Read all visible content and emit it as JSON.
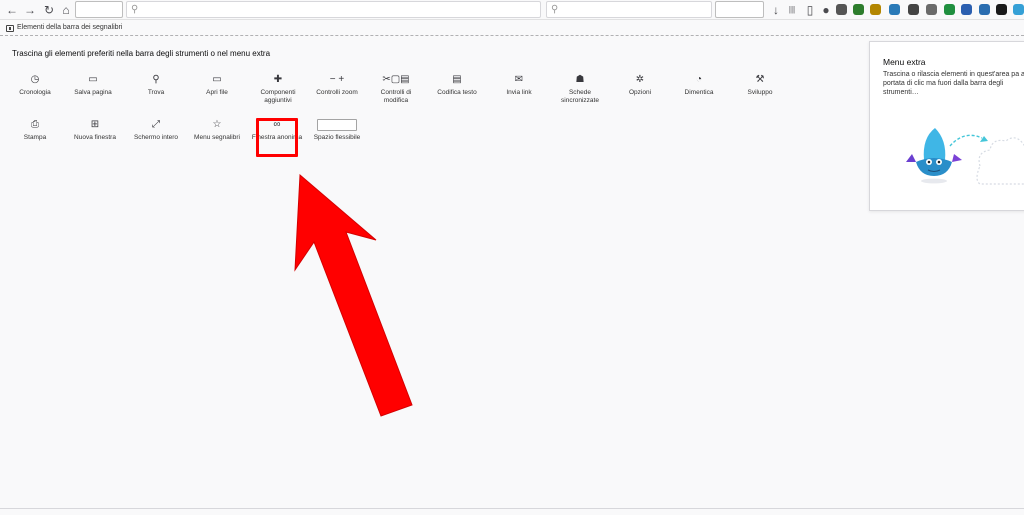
{
  "toolbar": {
    "back_icon": "←",
    "forward_icon": "→",
    "reload_icon": "↻",
    "home_icon": "⌂",
    "search_glyph": "⚲",
    "download_icon": "↓",
    "library_icon": "|||",
    "sidebar_icon": "▯",
    "account_icon": "●",
    "extensions_colors": [
      "#555555",
      "#2d7d2d",
      "#b38600",
      "#2a7ab8",
      "#444444",
      "#6a6a6a",
      "#1f8f3f",
      "#2b5fb0",
      "#2a6db0",
      "#1a1a1a",
      "#35a0d6",
      "#444444"
    ]
  },
  "bookmarks": {
    "label": "Elementi della barra dei segnalibri"
  },
  "main": {
    "instruction": "Trascina gli elementi preferiti nella barra degli strumenti o nel menu extra",
    "row1": [
      {
        "icon": "◷",
        "label": "Cronologia"
      },
      {
        "icon": "▭",
        "label": "Salva pagina"
      },
      {
        "icon": "⚲",
        "label": "Trova"
      },
      {
        "icon": "▭",
        "label": "Apri file"
      },
      {
        "icon": "✚",
        "label": "Componenti aggiuntivi"
      },
      {
        "icon": "− +",
        "label": "Controlli zoom"
      },
      {
        "icon": "✂▢▤",
        "label": "Controlli di modifica"
      },
      {
        "icon": "▤",
        "label": "Codifica testo"
      },
      {
        "icon": "✉",
        "label": "Invia link"
      },
      {
        "icon": "☗",
        "label": "Schede sincronizzate"
      },
      {
        "icon": "✲",
        "label": "Opzioni"
      },
      {
        "icon": "◔",
        "label": "Dimentica"
      },
      {
        "icon": "⚒",
        "label": "Sviluppo"
      }
    ],
    "row2": [
      {
        "icon": "⎙",
        "label": "Stampa"
      },
      {
        "icon": "⊞",
        "label": "Nuova finestra"
      },
      {
        "icon": "⤢",
        "label": "Schermo intero"
      },
      {
        "icon": "☆",
        "label": "Menu segnalibri"
      },
      {
        "icon": "∞",
        "label": "Finestra anonima"
      },
      {
        "icon": "",
        "label": "Spazio flessibile"
      }
    ]
  },
  "panel": {
    "title": "Menu extra",
    "description": "Trascina o rilascia elementi in quest'area pa a portata di clic ma fuori dalla barra degli strumenti…"
  },
  "colors": {
    "highlight": "#ff0000",
    "arrow": "#ff0000"
  }
}
